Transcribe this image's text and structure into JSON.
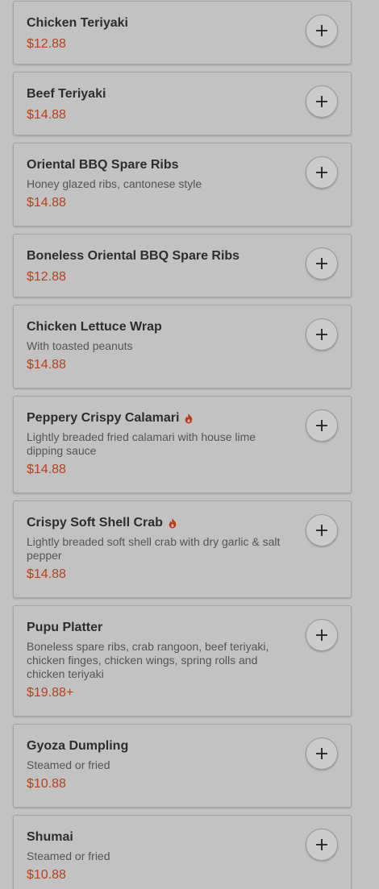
{
  "colors": {
    "background": "#c2c2c2",
    "price": "#b7411d",
    "spicy": "#c0391b"
  },
  "items": [
    {
      "name": "Chicken Teriyaki",
      "description": "",
      "price": "$12.88",
      "spicy": false
    },
    {
      "name": "Beef Teriyaki",
      "description": "",
      "price": "$14.88",
      "spicy": false
    },
    {
      "name": "Oriental BBQ Spare Ribs",
      "description": "Honey glazed ribs, cantonese style",
      "price": "$14.88",
      "spicy": false
    },
    {
      "name": "Boneless Oriental BBQ Spare Ribs",
      "description": "",
      "price": "$12.88",
      "spicy": false
    },
    {
      "name": "Chicken Lettuce Wrap",
      "description": "With toasted peanuts",
      "price": "$14.88",
      "spicy": false
    },
    {
      "name": "Peppery Crispy Calamari",
      "description": "Lightly breaded fried calamari with house lime dipping sauce",
      "price": "$14.88",
      "spicy": true
    },
    {
      "name": "Crispy Soft Shell Crab",
      "description": "Lightly breaded soft shell crab with dry garlic & salt pepper",
      "price": "$14.88",
      "spicy": true
    },
    {
      "name": "Pupu Platter",
      "description": "Boneless spare ribs, crab rangoon, beef teriyaki, chicken finges, chicken wings, spring rolls and chicken teriyaki",
      "price": "$19.88+",
      "spicy": false
    },
    {
      "name": "Gyoza Dumpling",
      "description": "Steamed or fried",
      "price": "$10.88",
      "spicy": false
    },
    {
      "name": "Shumai",
      "description": "Steamed or fried",
      "price": "$10.88",
      "spicy": false
    }
  ]
}
